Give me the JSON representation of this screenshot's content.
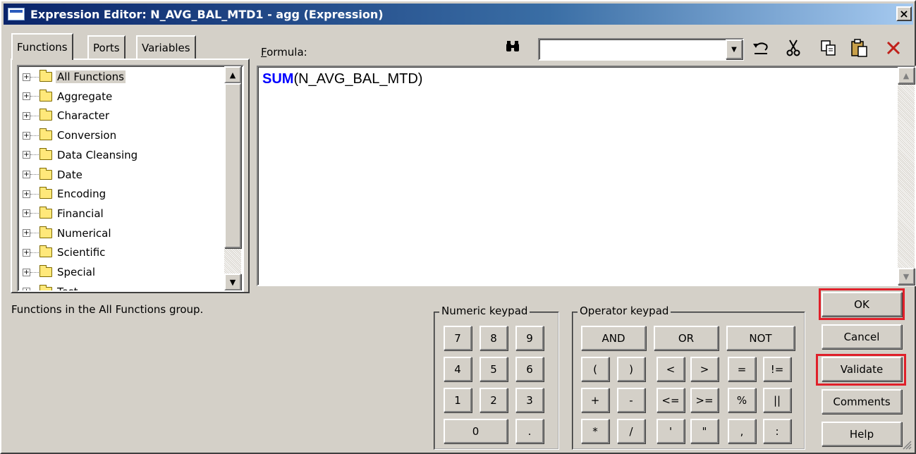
{
  "window": {
    "title": "Expression Editor: N_AVG_BAL_MTD1 - agg (Expression)",
    "close_glyph": "×"
  },
  "tabs": [
    {
      "label": "Functions",
      "active": true
    },
    {
      "label": "Ports",
      "active": false
    },
    {
      "label": "Variables",
      "active": false
    }
  ],
  "function_tree": {
    "items": [
      "All Functions",
      "Aggregate",
      "Character",
      "Conversion",
      "Data Cleansing",
      "Date",
      "Encoding",
      "Financial",
      "Numerical",
      "Scientific",
      "Special",
      "Test"
    ],
    "selected": "All Functions"
  },
  "group_description": "Functions in the All Functions group.",
  "formula": {
    "label": "Formula:",
    "function_keyword": "SUM",
    "arguments": "(N_AVG_BAL_MTD)"
  },
  "toolbar": {
    "search_value": "",
    "icons": [
      "binoculars-icon",
      "undo-icon",
      "cut-icon",
      "copy-icon",
      "paste-icon",
      "delete-icon"
    ]
  },
  "numeric_keypad": {
    "title": "Numeric keypad",
    "rows": [
      [
        "7",
        "8",
        "9"
      ],
      [
        "4",
        "5",
        "6"
      ],
      [
        "1",
        "2",
        "3"
      ],
      [
        "0",
        "."
      ]
    ]
  },
  "operator_keypad": {
    "title": "Operator keypad",
    "logic": [
      "AND",
      "OR",
      "NOT"
    ],
    "rows": [
      [
        "(",
        ")",
        "<",
        ">",
        "=",
        "!="
      ],
      [
        "+",
        "-",
        "<=",
        ">=",
        "%",
        "||"
      ],
      [
        "*",
        "/",
        "'",
        "\"",
        ",",
        ":"
      ]
    ]
  },
  "buttons": {
    "ok": "OK",
    "cancel": "Cancel",
    "validate": "Validate",
    "comments": "Comments",
    "help": "Help"
  },
  "highlight_color": "#e0202a",
  "keyword_color": "#0000ff"
}
